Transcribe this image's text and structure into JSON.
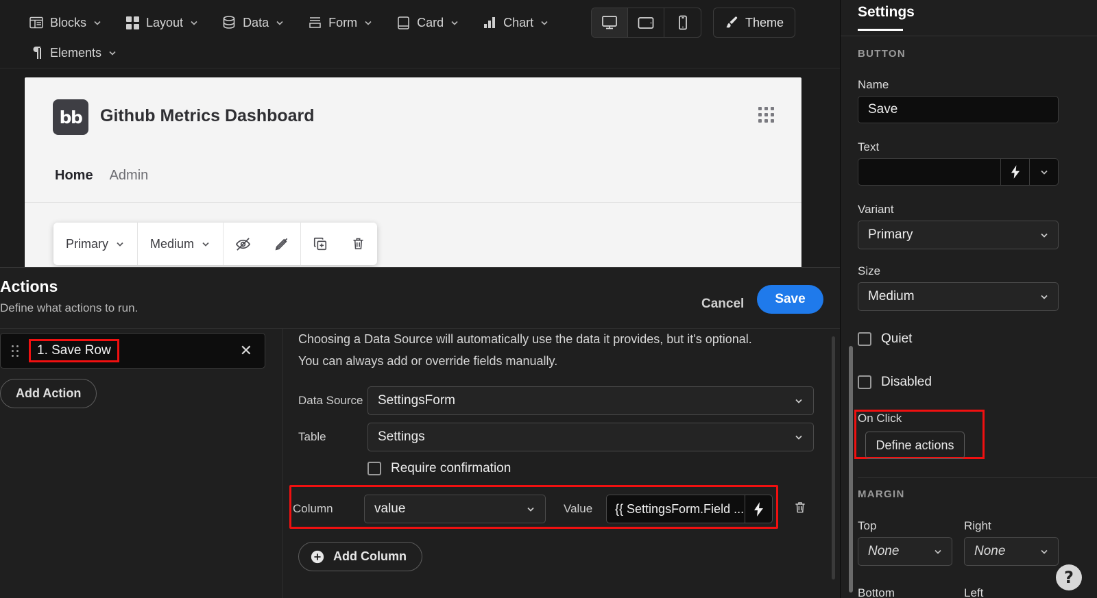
{
  "toolbar": {
    "menus": [
      {
        "label": "Blocks",
        "icon": "blocks-icon"
      },
      {
        "label": "Layout",
        "icon": "layout-icon"
      },
      {
        "label": "Data",
        "icon": "database-icon"
      },
      {
        "label": "Form",
        "icon": "form-icon"
      },
      {
        "label": "Card",
        "icon": "card-icon"
      },
      {
        "label": "Chart",
        "icon": "chart-icon"
      },
      {
        "label": "Elements",
        "icon": "paragraph-icon"
      }
    ],
    "devices": [
      {
        "name": "desktop-view",
        "icon": "monitor-icon",
        "active": true
      },
      {
        "name": "tablet-view",
        "icon": "tablet-icon",
        "active": false
      },
      {
        "name": "mobile-view",
        "icon": "phone-icon",
        "active": false
      }
    ],
    "theme_label": "Theme",
    "theme_icon": "brush-icon"
  },
  "preview": {
    "logo_text": "bb",
    "title": "Github Metrics Dashboard",
    "grid_icon": "app-grid-icon",
    "tabs": [
      {
        "label": "Home",
        "active": true
      },
      {
        "label": "Admin",
        "active": false
      }
    ],
    "float_toolbar": {
      "variant": "Primary",
      "size": "Medium",
      "icons": [
        "eye-off-icon",
        "pen-off-icon",
        "duplicate-icon",
        "trash-icon"
      ]
    }
  },
  "actions": {
    "title": "Actions",
    "subtitle": "Define what actions to run.",
    "cancel_label": "Cancel",
    "save_label": "Save",
    "list": [
      {
        "label": "1. Save Row",
        "close_icon": "close-icon",
        "highlighted": true
      }
    ],
    "add_action_label": "Add Action",
    "hint_line1": "Choosing a Data Source will automatically use the data it provides, but it's optional.",
    "hint_line2": "You can always add or override fields manually.",
    "fields": [
      {
        "label": "Data Source",
        "value": "SettingsForm"
      },
      {
        "label": "Table",
        "value": "Settings"
      }
    ],
    "require_confirmation_label": "Require confirmation",
    "require_confirmation_checked": false,
    "column_row": {
      "column_label": "Column",
      "column_value": "value",
      "value_label": "Value",
      "value_value": "{{ SettingsForm.Field ...",
      "bolt_icon": "lightning-icon",
      "delete_icon": "trash-icon",
      "highlighted": true
    },
    "add_column_label": "Add Column",
    "add_column_icon": "plus-circle-icon"
  },
  "settings": {
    "tab_label": "Settings",
    "section_button": "BUTTON",
    "name_label": "Name",
    "name_value": "Save",
    "text_label": "Text",
    "text_value": "",
    "text_bolt_icon": "lightning-icon",
    "text_chevron_icon": "chevron-down-icon",
    "variant_label": "Variant",
    "variant_value": "Primary",
    "size_label": "Size",
    "size_value": "Medium",
    "quiet_label": "Quiet",
    "quiet_checked": false,
    "disabled_label": "Disabled",
    "disabled_checked": false,
    "on_click_label": "On Click",
    "define_actions_label": "Define actions",
    "section_margin": "MARGIN",
    "margin_top_label": "Top",
    "margin_top_value": "None",
    "margin_right_label": "Right",
    "margin_right_value": "None",
    "margin_bottom_label": "Bottom",
    "margin_left_label": "Left"
  },
  "help": {
    "label": "?"
  },
  "colors": {
    "accent_blue": "#1f7aeb",
    "highlight_red": "#f01010",
    "panel_bg": "#1f1f1f",
    "app_bg": "#1c1c1c"
  }
}
